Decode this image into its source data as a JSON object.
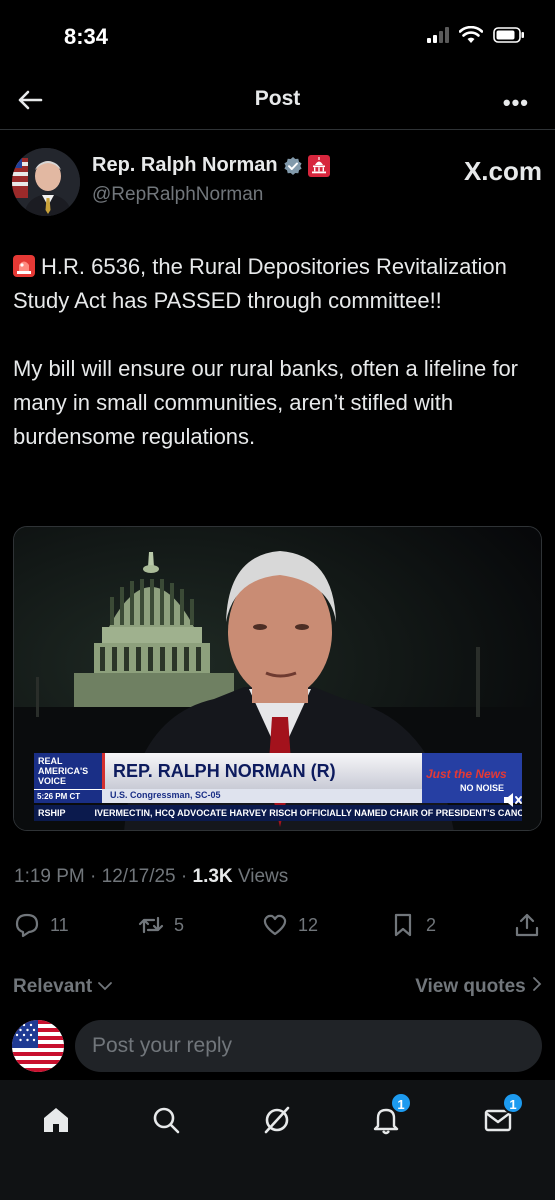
{
  "status_bar": {
    "time": "8:34"
  },
  "header": {
    "title": "Post"
  },
  "author": {
    "name": "Rep. Ralph Norman",
    "handle": "@RepRalphNorman",
    "source": "X.com"
  },
  "tweet": {
    "paragraph1": "H.R. 6536, the Rural Depositories Revitalization Study Act has PASSED through committee!!",
    "paragraph2": "My bill will ensure our rural banks, often a lifeline for many in small communities, aren’t stifled with burdensome regulations."
  },
  "video": {
    "channel_line1": "REAL",
    "channel_line2": "AMERICA'S",
    "channel_line3": "VOICE",
    "time": "5:26 PM CT",
    "name": "REP. RALPH NORMAN (R)",
    "title": "U.S. Congressman, SC-05",
    "brand_main": "Just the News",
    "brand_sub": "NO NOISE",
    "ticker_head": "RSHIP",
    "ticker_text": "IVERMECTIN, HCQ ADVOCATE HARVEY RISCH OFFICIALLY NAMED CHAIR OF PRESIDENT'S CANCER P"
  },
  "meta": {
    "time": "1:19 PM",
    "date": "12/17/25",
    "views_count": "1.3K",
    "views_label": "Views"
  },
  "actions": {
    "replies": "11",
    "reposts": "5",
    "likes": "12",
    "bookmarks": "2"
  },
  "sort": {
    "label": "Relevant",
    "quotes": "View quotes"
  },
  "reply": {
    "placeholder": "Post your reply"
  },
  "nav": {
    "notifications_badge": "1",
    "messages_badge": "1"
  },
  "colors": {
    "background": "#000000",
    "text_primary": "#e7e9ea",
    "text_secondary": "#71767b",
    "accent": "#1d9bf0",
    "verified": "#829aab"
  }
}
